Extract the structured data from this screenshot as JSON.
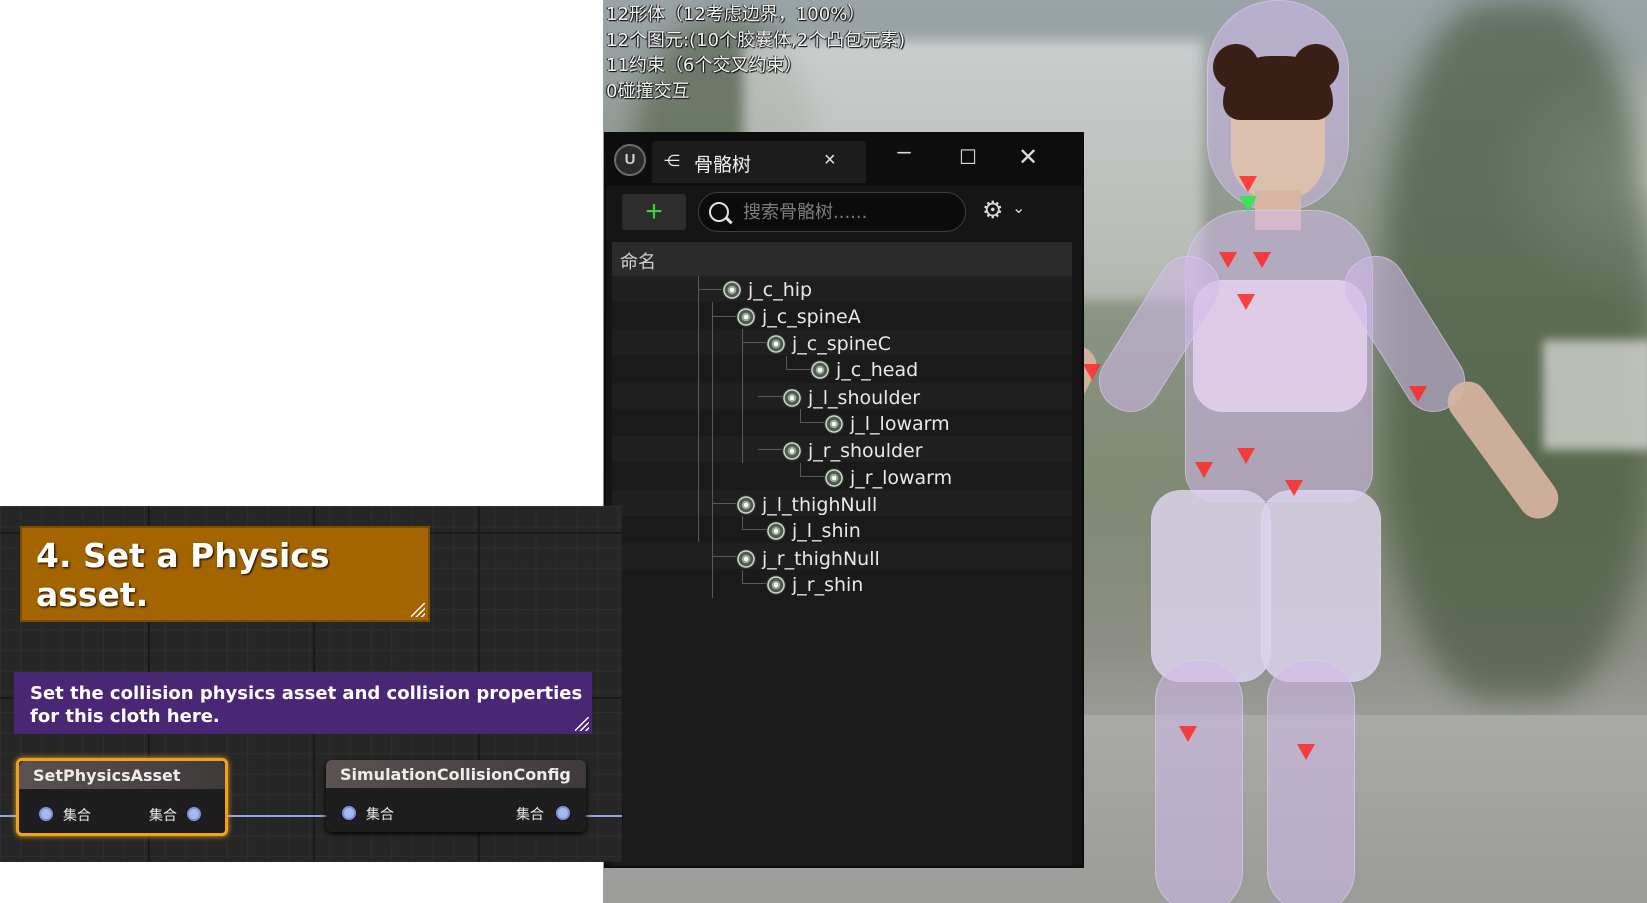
{
  "viewport": {
    "stats": [
      "12形体（12考虑边界，100%）",
      "12个图元:(10个胶囊体,2个凸包元素)",
      "11约束（6个交叉约束）",
      "0碰撞交互"
    ]
  },
  "skeleton_tree": {
    "tab_title": "骨骼树",
    "tab_icon": "skeleton-tree-icon",
    "add_label": "+",
    "search_placeholder": "搜索骨骼树......",
    "column_header": "命名",
    "bones": [
      {
        "name": "j_c_hip",
        "depth": 0
      },
      {
        "name": "j_c_spineA",
        "depth": 1
      },
      {
        "name": "j_c_spineC",
        "depth": 2
      },
      {
        "name": "j_c_head",
        "depth": 3
      },
      {
        "name": "j_l_shoulder",
        "depth": 2
      },
      {
        "name": "j_l_lowarm",
        "depth": 3
      },
      {
        "name": "j_r_shoulder",
        "depth": 2
      },
      {
        "name": "j_r_lowarm",
        "depth": 3
      },
      {
        "name": "j_l_thighNull",
        "depth": 1
      },
      {
        "name": "j_l_shin",
        "depth": 2
      },
      {
        "name": "j_r_thighNull",
        "depth": 1
      },
      {
        "name": "j_r_shin",
        "depth": 2
      }
    ]
  },
  "graph": {
    "comment_orange": "4. Set a Physics asset.",
    "comment_purple": "Set the collision physics asset and collision properties for this cloth here.",
    "node_setphysics": {
      "title": "SetPhysicsAsset",
      "pin_in": "集合",
      "pin_out": "集合"
    },
    "node_simcollision": {
      "title": "SimulationCollisionConfig",
      "pin_in": "集合",
      "pin_out": "集合"
    }
  },
  "colors": {
    "comment_orange": "#a46500",
    "comment_purple": "#4a2775",
    "selection": "#f0a21a",
    "add_green": "#3fce3f"
  }
}
